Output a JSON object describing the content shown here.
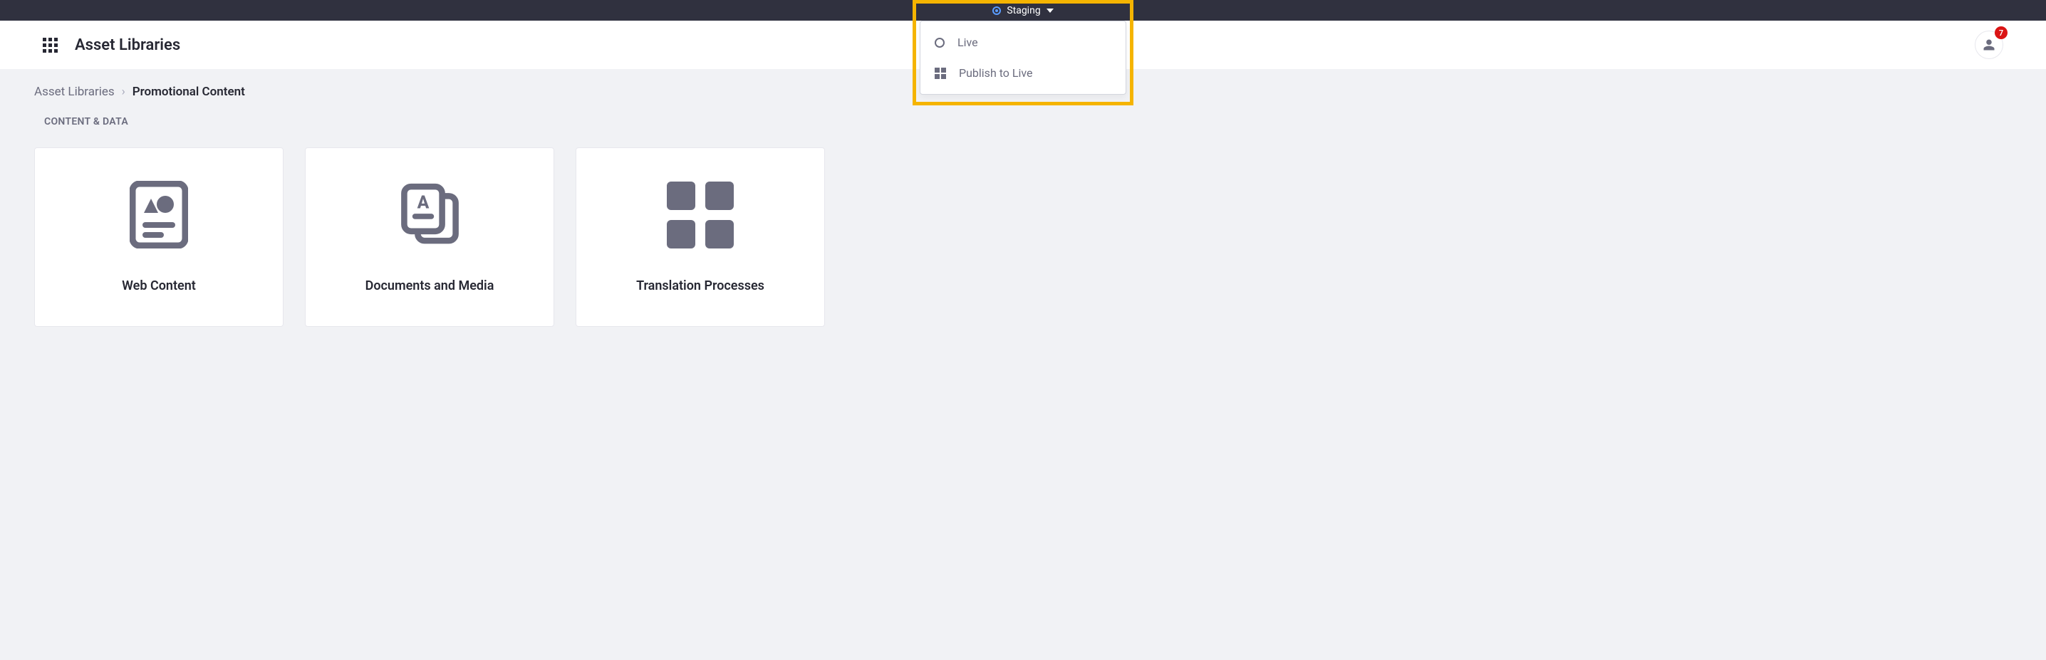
{
  "topbar": {
    "environment_label": "Staging"
  },
  "dropdown": {
    "items": [
      {
        "icon": "radio-outline",
        "label": "Live"
      },
      {
        "icon": "grid-small",
        "label": "Publish to Live"
      }
    ]
  },
  "header": {
    "title": "Asset Libraries",
    "notifications_count": "7"
  },
  "breadcrumb": {
    "root": "Asset Libraries",
    "current": "Promotional Content"
  },
  "section": {
    "label": "CONTENT & DATA"
  },
  "cards": [
    {
      "label": "Web Content",
      "icon": "web-content"
    },
    {
      "label": "Documents and Media",
      "icon": "documents"
    },
    {
      "label": "Translation Processes",
      "icon": "grid"
    }
  ]
}
